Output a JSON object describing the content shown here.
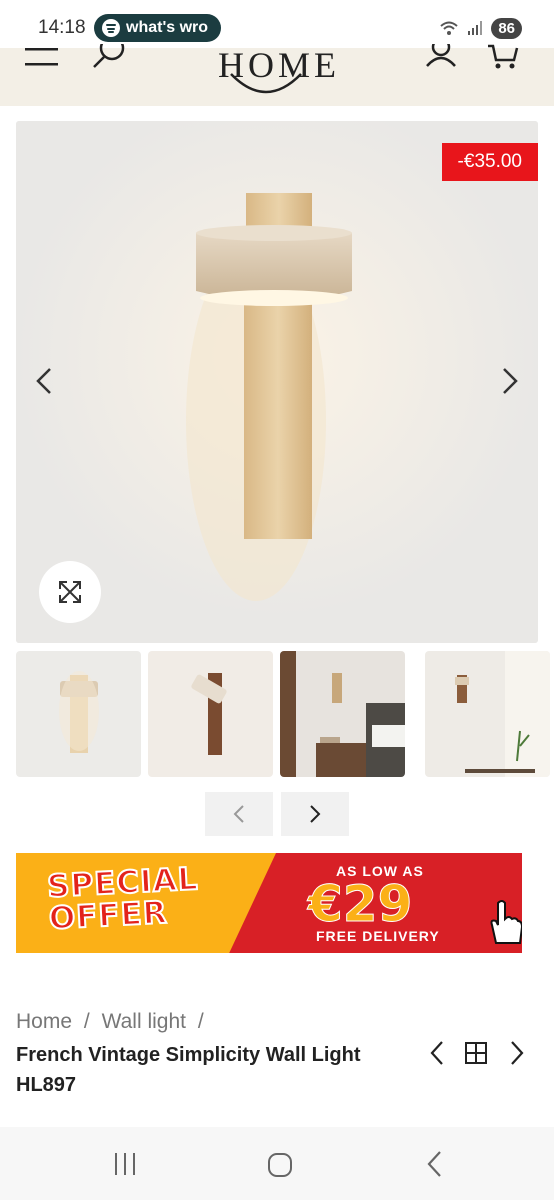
{
  "status_bar": {
    "time": "14:18",
    "media_text": "what's wro",
    "battery": "86"
  },
  "header": {
    "logo": "HOME"
  },
  "gallery": {
    "discount_badge": "-€35.00"
  },
  "banner": {
    "headline_line1": "SPECIAL",
    "headline_line2": "OFFER",
    "tag": "AS LOW AS",
    "price": "€29",
    "subtext": "FREE DELIVERY"
  },
  "breadcrumb": {
    "items": [
      "Home",
      "Wall light"
    ],
    "separator": "/"
  },
  "product": {
    "title": "French Vintage Simplicity Wall Light HL897"
  },
  "colors": {
    "discount_red": "#e8151b",
    "header_bg": "#f3efe6",
    "banner_yellow": "#fbb017",
    "banner_red": "#d82026"
  }
}
